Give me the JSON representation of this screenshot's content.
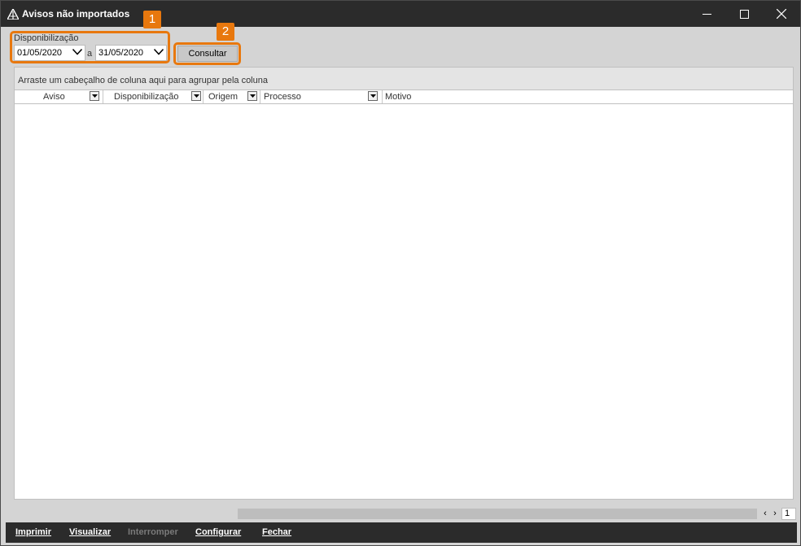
{
  "window": {
    "title": "Avisos não importados",
    "icon": "app-logo-icon",
    "controls": [
      "minimize-icon",
      "maximize-icon",
      "close-icon"
    ]
  },
  "filter": {
    "label": "Disponibilização",
    "date_from": "01/05/2020",
    "separator": "a",
    "date_to": "31/05/2020",
    "consult_label": "Consultar"
  },
  "annotations": {
    "badge1": "1",
    "badge2": "2",
    "accent_color": "#e8780e"
  },
  "grid": {
    "group_hint": "Arraste um cabeçalho de coluna aqui para agrupar pela coluna",
    "columns": [
      "Aviso",
      "Disponibilização",
      "Origem",
      "Processo",
      "Motivo"
    ],
    "rows": []
  },
  "pager": {
    "prev": "‹",
    "next": "›",
    "page": "1"
  },
  "footer": {
    "buttons": [
      {
        "label": "Imprimir",
        "enabled": true
      },
      {
        "label": "Visualizar",
        "enabled": true
      },
      {
        "label": "Interromper",
        "enabled": false
      },
      {
        "label": "Configurar",
        "enabled": true
      },
      {
        "label": "Fechar",
        "enabled": true
      }
    ]
  }
}
